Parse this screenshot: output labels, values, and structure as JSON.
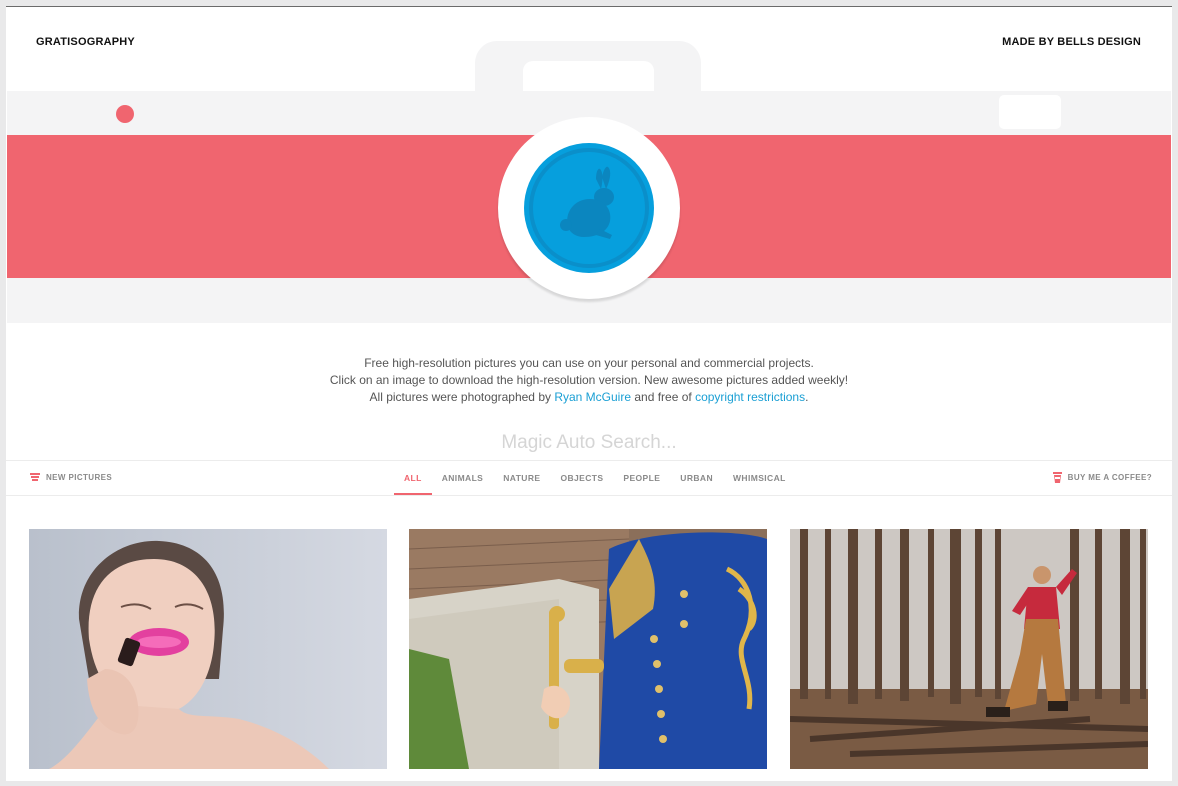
{
  "header": {
    "logo": "GRATISOGRAPHY",
    "credit": "MADE BY BELLS DESIGN"
  },
  "intro": {
    "line1": "Free high-resolution pictures you can use on your personal and commercial projects.",
    "line2": "Click on an image to download the high-resolution version. New awesome pictures added weekly!",
    "line3_prefix": "All pictures were photographed by ",
    "author_link": "Ryan McGuire",
    "line3_middle": " and free of ",
    "copyright_link": "copyright restrictions",
    "line3_suffix": "."
  },
  "search": {
    "placeholder": "Magic Auto Search..."
  },
  "nav": {
    "new_pictures": "NEW PICTURES",
    "coffee": "BUY ME A COFFEE?",
    "categories": [
      "ALL",
      "ANIMALS",
      "NATURE",
      "OBJECTS",
      "PEOPLE",
      "URBAN",
      "WHIMSICAL"
    ],
    "active_category": "ALL"
  },
  "colors": {
    "accent": "#f0656f",
    "lens": "#069fdd",
    "link": "#1a9fd4"
  },
  "icons": {
    "lens_figure": "rabbit-icon",
    "new_pictures": "stack-icon",
    "coffee": "cup-icon"
  }
}
